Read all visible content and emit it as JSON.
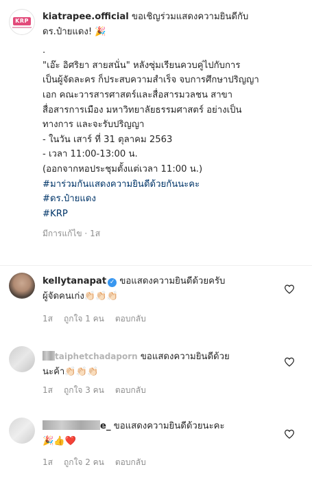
{
  "post": {
    "username": "kiatrapee.official",
    "line1_rest": " ขอเชิญร่วมแสดงความยินดีกับ",
    "line2": "ดร.ป๋ายแดง! 🎉",
    "dot": ".",
    "body": [
      "\"เอ๊ะ อิศริยา สายสนั่น\" หลังซุ่มเรียนควบคู่ไปกับการ",
      "เป็นผู้จัดละคร ก็ประสบความสำเร็จ จบการศึกษาปริญญา",
      "เอก คณะวารสารศาสตร์และสื่อสารมวลชน สาขา",
      "สื่อสารการเมือง มหาวิทยาลัยธรรมศาสตร์ อย่างเป็น",
      "ทางการ และจะรับปริญญา",
      "- ในวัน เสาร์ ที่ 31 ตุลาคม 2563",
      "- เวลา 11:00-13:00 น.",
      "(ออกจากหอประชุมตั้งแต่เวลา 11:00 น.)"
    ],
    "hashtags": [
      "#มาร่วมกันแสดงความยินดีด้วยกันนะคะ",
      "#ดร.ป๋ายแดง",
      "#KRP"
    ],
    "edited": "มีการแก้ไข",
    "time": "1ส"
  },
  "avatar_logo": "KRP",
  "comments": [
    {
      "username": "kellytanapat",
      "verified_icon": "✓",
      "text_line1": " ขอแสดงความยินดีด้วยครับ",
      "text_line2": "ผู้จัดคนเก่ง👏🏻👏🏻👏🏻",
      "time": "1ส",
      "likes": "ถูกใจ 1 คน",
      "reply": "ตอบกลับ"
    },
    {
      "username": "taiphetchadaporn",
      "text_line1": " ขอแสดงความยินดีด้วย",
      "text_line2": "นะค้า👏🏻👏🏻👏🏻",
      "time": "1ส",
      "likes": "ถูกใจ 3 คน",
      "reply": "ตอบกลับ"
    },
    {
      "username_tail": "e_",
      "text_line1": " ขอแสดงความยินดีด้วยนะคะ",
      "text_line2": "🎉👍❤️",
      "time": "1ส",
      "likes": "ถูกใจ 2 คน",
      "reply": "ตอบกลับ"
    }
  ],
  "colors": {
    "text": "#262626",
    "meta": "#8e8e8e",
    "hashtag": "#003569",
    "verified": "#3897f0",
    "brand": "#e24a7a"
  },
  "icons": {
    "like": "heart-outline-icon"
  }
}
